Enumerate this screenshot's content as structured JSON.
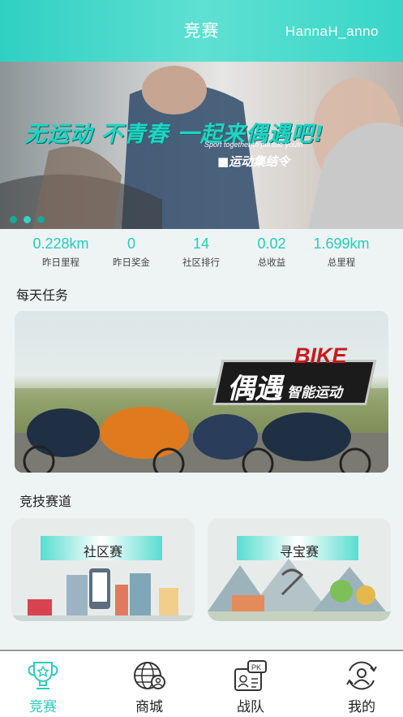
{
  "header": {
    "title": "竞赛",
    "username": "HannaH_anno"
  },
  "banner": {
    "slogan": "无运动 不青春 一起来偶遇吧!",
    "subtitle": "Sport together to pursue youth",
    "tag": "■运动集结令",
    "carousel_dots": 3,
    "active_dot": 1
  },
  "stats": [
    {
      "value": "0.228km",
      "label": "昨日里程"
    },
    {
      "value": "0",
      "label": "昨日奖金"
    },
    {
      "value": "14",
      "label": "社区排行"
    },
    {
      "value": "0.02",
      "label": "总收益"
    },
    {
      "value": "1.699km",
      "label": "总里程"
    }
  ],
  "daily_task": {
    "title": "每天任务",
    "promo_word": "BIKE",
    "promo_main": "偶遇",
    "promo_sub": "智能运动"
  },
  "tracks": {
    "title": "竞技赛道",
    "items": [
      {
        "label": "社区赛"
      },
      {
        "label": "寻宝赛"
      }
    ]
  },
  "nav": {
    "items": [
      {
        "label": "竞赛",
        "icon": "trophy-icon",
        "active": true
      },
      {
        "label": "商城",
        "icon": "globe-shop-icon",
        "active": false
      },
      {
        "label": "战队",
        "icon": "team-pk-icon",
        "active": false
      },
      {
        "label": "我的",
        "icon": "profile-icon",
        "active": false
      }
    ],
    "pk_badge": "PK"
  },
  "colors": {
    "accent": "#2ccabd",
    "header": "#3fd6c9"
  }
}
